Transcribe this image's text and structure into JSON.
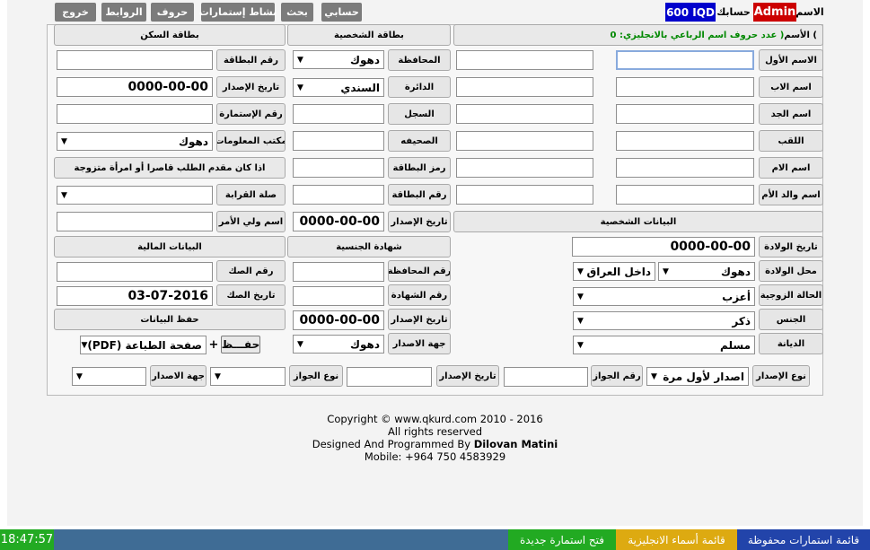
{
  "topbar": {
    "name_label": "الاسم",
    "user": "Admin",
    "account_label": "حسابك",
    "balance": "600 IQD",
    "buttons": [
      "حسابي",
      "بحث",
      "نشاط إستمارات",
      "حروف",
      "الروابط",
      "خروج"
    ]
  },
  "headers": {
    "name_prefix": "الأسم (",
    "name_count": " عدد حروف اسم الرباعي بالانجليزي: 0 )",
    "id_card": "بطاقة الشخصية",
    "residence_card": "بطاقة السكن",
    "personal_data": "البيانات الشخصية",
    "nationality_cert": "شهادة الجنسية",
    "financial_data": "البيانات المالية",
    "save_data": "حفظ البيانات"
  },
  "personal": {
    "first_name": "الاسم الأول",
    "father_name": "اسم الاب",
    "grandfather_name": "اسم الجد",
    "surname": "اللقب",
    "mother_name": "اسم الام",
    "mother_father": "اسم والد الأم",
    "birth_date_label": "تاريخ الولادة",
    "birth_date": "0000-00-00",
    "birth_place_label": "محل الولادة",
    "birth_place_region": "داخل العراق",
    "birth_place_city": "دهوك",
    "marital_label": "الحالة الزوجية",
    "marital_value": "أعزب",
    "gender_label": "الجنس",
    "gender_value": "ذكر",
    "religion_label": "الديانة",
    "religion_value": "مسلم"
  },
  "idcard": {
    "governorate_label": "المحافظة",
    "governorate_value": "دهوك",
    "district_label": "الدائرة",
    "district_value": "السندي",
    "record_label": "السجل",
    "page_label": "الصحيفه",
    "card_code_label": "رمز البطاقة",
    "card_number_label": "رقم البطاقة",
    "issue_date_label": "تاريخ الإصدار",
    "issue_date": "0000-00-00"
  },
  "residence": {
    "card_number_label": "رقم البطاقة",
    "issue_date_label": "تاريخ الإصدار",
    "issue_date": "0000-00-00",
    "form_number_label": "رقم الإستمارة",
    "info_office_label": "مكتب المعلومات",
    "info_office_value": "دهوك",
    "minor_note": "اذا كان مقدم الطلب قاصرا أو امرأة متزوجة",
    "kinship_label": "صلة القرابة",
    "guardian_label": "اسم ولي الأمر"
  },
  "nationality": {
    "governorate_no_label": "رقم المحافظة",
    "cert_no_label": "رقم الشهادة",
    "issue_date_label": "تاريخ الإصدار",
    "issue_date": "0000-00-00",
    "issuer_label": "جهة الاصدار",
    "issuer_value": "دهوك"
  },
  "financial": {
    "deed_no_label": "رقم الصك",
    "deed_date_label": "تاريخ الصك",
    "deed_date": "03-07-2016"
  },
  "save": {
    "save_button": "حفـــظ",
    "plus": "+",
    "print_option": "صفحة الطباعة (PDF)"
  },
  "passport": {
    "issue_type_label": "نوع الإصدار",
    "issue_type_value": "اصدار لأول مرة",
    "passport_no_label": "رقم الجواز",
    "issue_date_label": "تاريخ الإصدار",
    "passport_type_label": "نوع الجواز",
    "issuer_label": "جهة الاصدار"
  },
  "footer": {
    "copyright": "Copyright © www.qkurd.com 2010 - 2016",
    "rights": "All rights reserved",
    "designed_prefix": "Designed And Programmed By ",
    "designer": "Dilovan Matini",
    "mobile": "Mobile: +964 750 4583929"
  },
  "taskbar": {
    "saved_forms": "قائمة استمارات محفوظة",
    "english_names": "قائمة أسماء الانجليزية",
    "new_form": "فتح استمارة جديدة",
    "clock": "18:47:57"
  },
  "colors": {
    "user_bg": "#cc0000",
    "balance_bg": "#0000cc",
    "count_text": "#008800",
    "taskbar": "#3f6c95",
    "task_blue": "#2244aa",
    "task_yellow": "#ddaa11",
    "task_green": "#22aa22"
  }
}
